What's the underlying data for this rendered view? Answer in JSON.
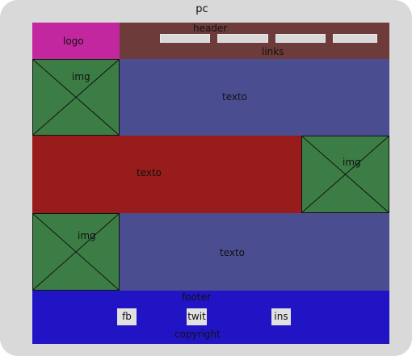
{
  "frame": {
    "label": "pc"
  },
  "logo": {
    "label": "logo"
  },
  "header": {
    "label": "header",
    "links_label": "links"
  },
  "rows": [
    {
      "image_label": "img",
      "text_label": "texto"
    },
    {
      "text_label": "texto",
      "image_label": "img"
    },
    {
      "image_label": "img",
      "text_label": "texto"
    }
  ],
  "footer": {
    "label": "footer",
    "buttons": [
      "fb",
      "twit",
      "ins"
    ],
    "copyright": "copyright"
  },
  "colors": {
    "frame": "#d9d9d9",
    "logo": "#c3279f",
    "header": "#6d3b3a",
    "image_placeholder": "#3c7d46",
    "text_panel_primary": "#4b4d91",
    "text_panel_secondary": "#981c1c",
    "footer": "#2114c4",
    "link_box": "#d9d9d9"
  }
}
